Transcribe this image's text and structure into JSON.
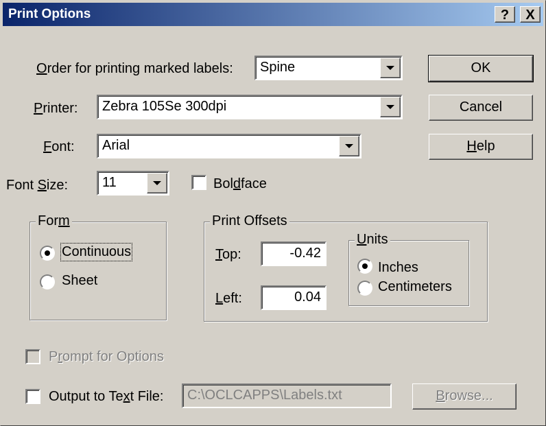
{
  "window": {
    "title": "Print Options",
    "help_glyph": "?",
    "close_glyph": "X"
  },
  "order": {
    "label": "Order for printing marked labels:",
    "value": "Spine"
  },
  "printer": {
    "label": "Printer:",
    "value": "Zebra 105Se 300dpi"
  },
  "font": {
    "label": "Font:",
    "value": "Arial"
  },
  "font_size": {
    "label": "Font Size:",
    "value": "11"
  },
  "boldface": {
    "label": "Boldface",
    "checked": false
  },
  "buttons": {
    "ok": "OK",
    "cancel": "Cancel",
    "help": "Help",
    "browse": "Browse..."
  },
  "form_group": {
    "title": "Form",
    "continuous": "Continuous",
    "sheet": "Sheet",
    "selected": "Continuous"
  },
  "offsets": {
    "title": "Print Offsets",
    "top_label": "Top:",
    "top_value": "-0.42",
    "left_label": "Left:",
    "left_value": "0.04"
  },
  "units": {
    "title": "Units",
    "inches": "Inches",
    "centimeters": "Centimeters",
    "selected": "Inches"
  },
  "prompt_options": {
    "label": "Prompt for Options",
    "checked": false,
    "enabled": false
  },
  "output_text": {
    "label": "Output to Text File:",
    "checked": false,
    "path": "C:\\OCLCAPPS\\Labels.txt"
  }
}
